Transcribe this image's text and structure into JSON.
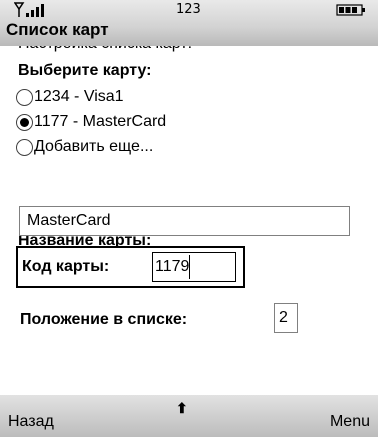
{
  "status_bar": {
    "signal_icon": "signal-strength-icon",
    "center_text": "123",
    "battery_icon": "battery-icon"
  },
  "title": "Список карт",
  "clipped_text": "Настройка списка карт:",
  "card_choice": {
    "label": "Выберите карту:",
    "options": [
      {
        "label": "1234 - Visa1",
        "checked": false
      },
      {
        "label": "1177 - MasterCard",
        "checked": true
      },
      {
        "label": "Добавить еще...",
        "checked": false
      }
    ]
  },
  "card_name": {
    "label": "Название карты:",
    "value": "MasterCard"
  },
  "card_code": {
    "label": "Код карты:",
    "value": "1179"
  },
  "list_position": {
    "label": "Положение в списке:",
    "value": "2"
  },
  "softkeys": {
    "left": "Назад",
    "center_icon": "up-arrow-icon",
    "center_glyph": "⬆",
    "right": "Menu"
  }
}
